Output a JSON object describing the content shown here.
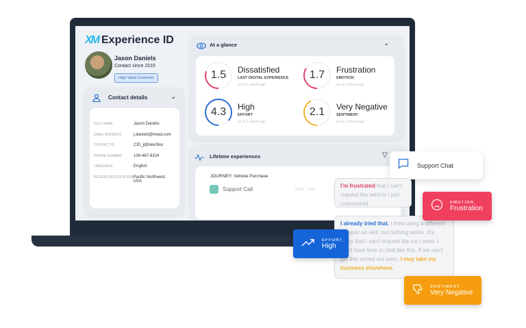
{
  "app": {
    "logo_mark": "XM",
    "title": "Experience ID"
  },
  "profile": {
    "name": "Jason Daniels",
    "since": "Contact since 2015",
    "badge": "High Value Customer"
  },
  "contact": {
    "title": "Contact details",
    "fields": [
      {
        "label": "Full name",
        "value": "Jason Daniels"
      },
      {
        "label": "Email address",
        "value": "j.daniels@tread.com"
      },
      {
        "label": "Contact ID",
        "value": "CID_jdjfoew3lxo"
      },
      {
        "label": "Phone number",
        "value": "104-467-8324"
      },
      {
        "label": "Language",
        "value": "English"
      },
      {
        "label": "Region geolocation",
        "value": "Pacific Northwest, USA"
      }
    ]
  },
  "glance": {
    "title": "At a glance",
    "metrics": [
      {
        "score": "1.5",
        "title": "Dissatisfied",
        "sub": "Last digital experience",
        "time": "as of 1 minute ago",
        "color": "#e0436a",
        "fill": 0.3
      },
      {
        "score": "1.7",
        "title": "Frustration",
        "sub": "Emotion",
        "time": "as of 1 minute ago",
        "color": "#e0436a",
        "fill": 0.34
      },
      {
        "score": "4.3",
        "title": "High",
        "sub": "Effort",
        "time": "as of 1 minute ago",
        "color": "#2b6fcf",
        "fill": 0.86
      },
      {
        "score": "2.1",
        "title": "Very Negative",
        "sub": "Sentiment",
        "time": "as of 1 minute ago",
        "color": "#f0b32f",
        "fill": 0.42
      }
    ]
  },
  "lifetime": {
    "title": "Lifetime experiences",
    "journey": "JOURNEY: Vehicle Purchase",
    "item": "Support Call",
    "item_meta": "00:00 · 1 min"
  },
  "support_chat": {
    "label": "Support Chat"
  },
  "chat": {
    "m1_hl": "I'm frustrated",
    "m1_rest": " that I can't request the vehicle I just customized",
    "m2_hl": "I already tried that.",
    "m2_rest": " I tried using a different browser as well, but nothing works. It's crazy that I can't request the car I want. I don't have time to chat like this. If we can't get this sorted out soon, ",
    "m2_end": "I may take my business elsewhere."
  },
  "tags": {
    "emotion": {
      "key": "EMOTION_",
      "value": "Frustration",
      "color": "#f0405e"
    },
    "effort": {
      "key": "EFFORT_",
      "value": "High",
      "color": "#1565d8"
    },
    "sentiment": {
      "key": "SENTIMENT_",
      "value": "Very Negative",
      "color": "#f59d0e"
    }
  }
}
